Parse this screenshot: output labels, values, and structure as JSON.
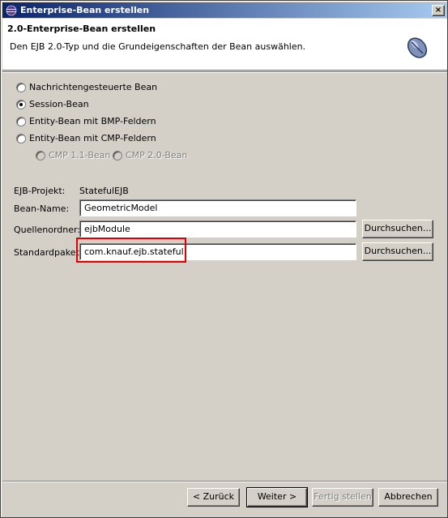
{
  "window": {
    "title": "Enterprise-Bean erstellen",
    "close_label": "×"
  },
  "banner": {
    "title": "2.0-Enterprise-Bean erstellen",
    "description": "Den EJB 2.0-Typ und die Grundeigenschaften der Bean auswählen."
  },
  "bean_types": [
    {
      "label": "Nachrichtengesteuerte Bean",
      "checked": false
    },
    {
      "label": "Session-Bean",
      "checked": true
    },
    {
      "label": "Entity-Bean mit BMP-Feldern",
      "checked": false
    },
    {
      "label": "Entity-Bean mit CMP-Feldern",
      "checked": false
    }
  ],
  "cmp_versions": [
    {
      "label": "CMP 1.1-Bean",
      "enabled": false
    },
    {
      "label": "CMP 2.0-Bean",
      "enabled": false
    }
  ],
  "form": {
    "project_label": "EJB-Projekt:",
    "project_value": "StatefulEJB",
    "bean_name_label": "Bean-Name:",
    "bean_name_value": "GeometricModel",
    "source_folder_label": "Quellenordner:",
    "source_folder_value": "ejbModule",
    "default_package_label": "Standardpaket:",
    "default_package_value": "com.knauf.ejb.stateful",
    "browse_label": "Durchsuchen..."
  },
  "footer": {
    "back_label": "< Zurück",
    "next_label": "Weiter >",
    "finish_label": "Fertig stellen",
    "cancel_label": "Abbrechen"
  },
  "colors": {
    "highlight": "#e00000",
    "titlebar_start": "#0a246a",
    "titlebar_end": "#a6caf0"
  }
}
